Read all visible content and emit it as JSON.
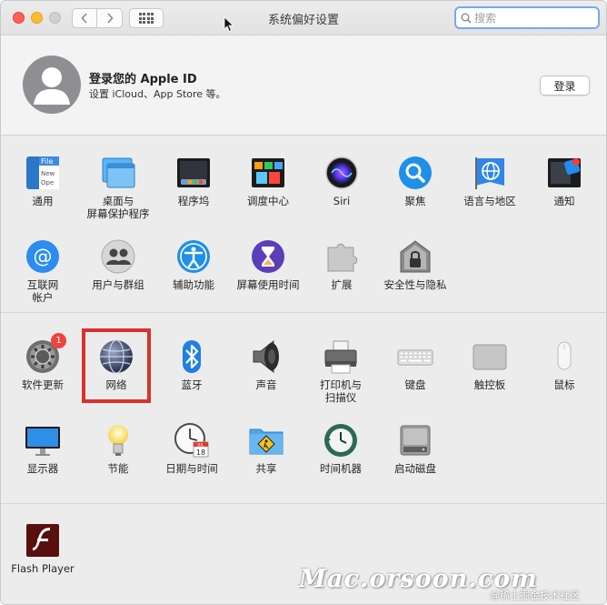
{
  "window": {
    "title": "系统偏好设置"
  },
  "search": {
    "placeholder": "搜索"
  },
  "account": {
    "title": "登录您的 Apple ID",
    "subtitle": "设置 iCloud、App Store 等。",
    "login_label": "登录"
  },
  "row1": [
    {
      "id": "general",
      "label": "通用",
      "icon": "general-icon"
    },
    {
      "id": "desktop",
      "label": "桌面与\n屏幕保护程序",
      "icon": "desktop-icon"
    },
    {
      "id": "dock",
      "label": "程序坞",
      "icon": "dock-icon"
    },
    {
      "id": "mission",
      "label": "调度中心",
      "icon": "mission-control-icon"
    },
    {
      "id": "siri",
      "label": "Siri",
      "icon": "siri-icon"
    },
    {
      "id": "spotlight",
      "label": "聚焦",
      "icon": "spotlight-icon"
    },
    {
      "id": "language",
      "label": "语言与地区",
      "icon": "language-region-icon"
    },
    {
      "id": "notifications",
      "label": "通知",
      "icon": "notifications-icon"
    }
  ],
  "row2": [
    {
      "id": "internet",
      "label": "互联网\n帐户",
      "icon": "internet-accounts-icon"
    },
    {
      "id": "users",
      "label": "用户与群组",
      "icon": "users-groups-icon"
    },
    {
      "id": "accessibility",
      "label": "辅助功能",
      "icon": "accessibility-icon"
    },
    {
      "id": "screentime",
      "label": "屏幕使用时间",
      "icon": "screen-time-icon"
    },
    {
      "id": "extensions",
      "label": "扩展",
      "icon": "extensions-icon"
    },
    {
      "id": "security",
      "label": "安全性与隐私",
      "icon": "security-privacy-icon"
    }
  ],
  "row3": [
    {
      "id": "software",
      "label": "软件更新",
      "icon": "software-update-icon",
      "badge": "1"
    },
    {
      "id": "network",
      "label": "网络",
      "icon": "network-icon"
    },
    {
      "id": "bluetooth",
      "label": "蓝牙",
      "icon": "bluetooth-icon"
    },
    {
      "id": "sound",
      "label": "声音",
      "icon": "sound-icon"
    },
    {
      "id": "printers",
      "label": "打印机与\n扫描仪",
      "icon": "printers-scanners-icon"
    },
    {
      "id": "keyboard",
      "label": "键盘",
      "icon": "keyboard-icon"
    },
    {
      "id": "trackpad",
      "label": "触控板",
      "icon": "trackpad-icon"
    },
    {
      "id": "mouse",
      "label": "鼠标",
      "icon": "mouse-icon"
    }
  ],
  "row4": [
    {
      "id": "displays",
      "label": "显示器",
      "icon": "displays-icon"
    },
    {
      "id": "energy",
      "label": "节能",
      "icon": "energy-saver-icon"
    },
    {
      "id": "datetime",
      "label": "日期与时间",
      "icon": "date-time-icon"
    },
    {
      "id": "sharing",
      "label": "共享",
      "icon": "sharing-icon"
    },
    {
      "id": "timemachine",
      "label": "时间机器",
      "icon": "time-machine-icon"
    },
    {
      "id": "startup",
      "label": "启动磁盘",
      "icon": "startup-disk-icon"
    }
  ],
  "row5": [
    {
      "id": "flash",
      "label": "Flash Player",
      "icon": "flash-player-icon"
    }
  ],
  "icon_text": {
    "general_file": "File",
    "general_new": "New",
    "general_open": "Ope",
    "calendar_month": "JUL",
    "calendar_day": "18"
  },
  "watermark": {
    "main": "Mac.orsoon.com",
    "sub": "@稀土掘金技术社区"
  },
  "colors": {
    "accent": "#7aa7f0",
    "highlight": "#d9322c",
    "badge": "#f0433c"
  }
}
